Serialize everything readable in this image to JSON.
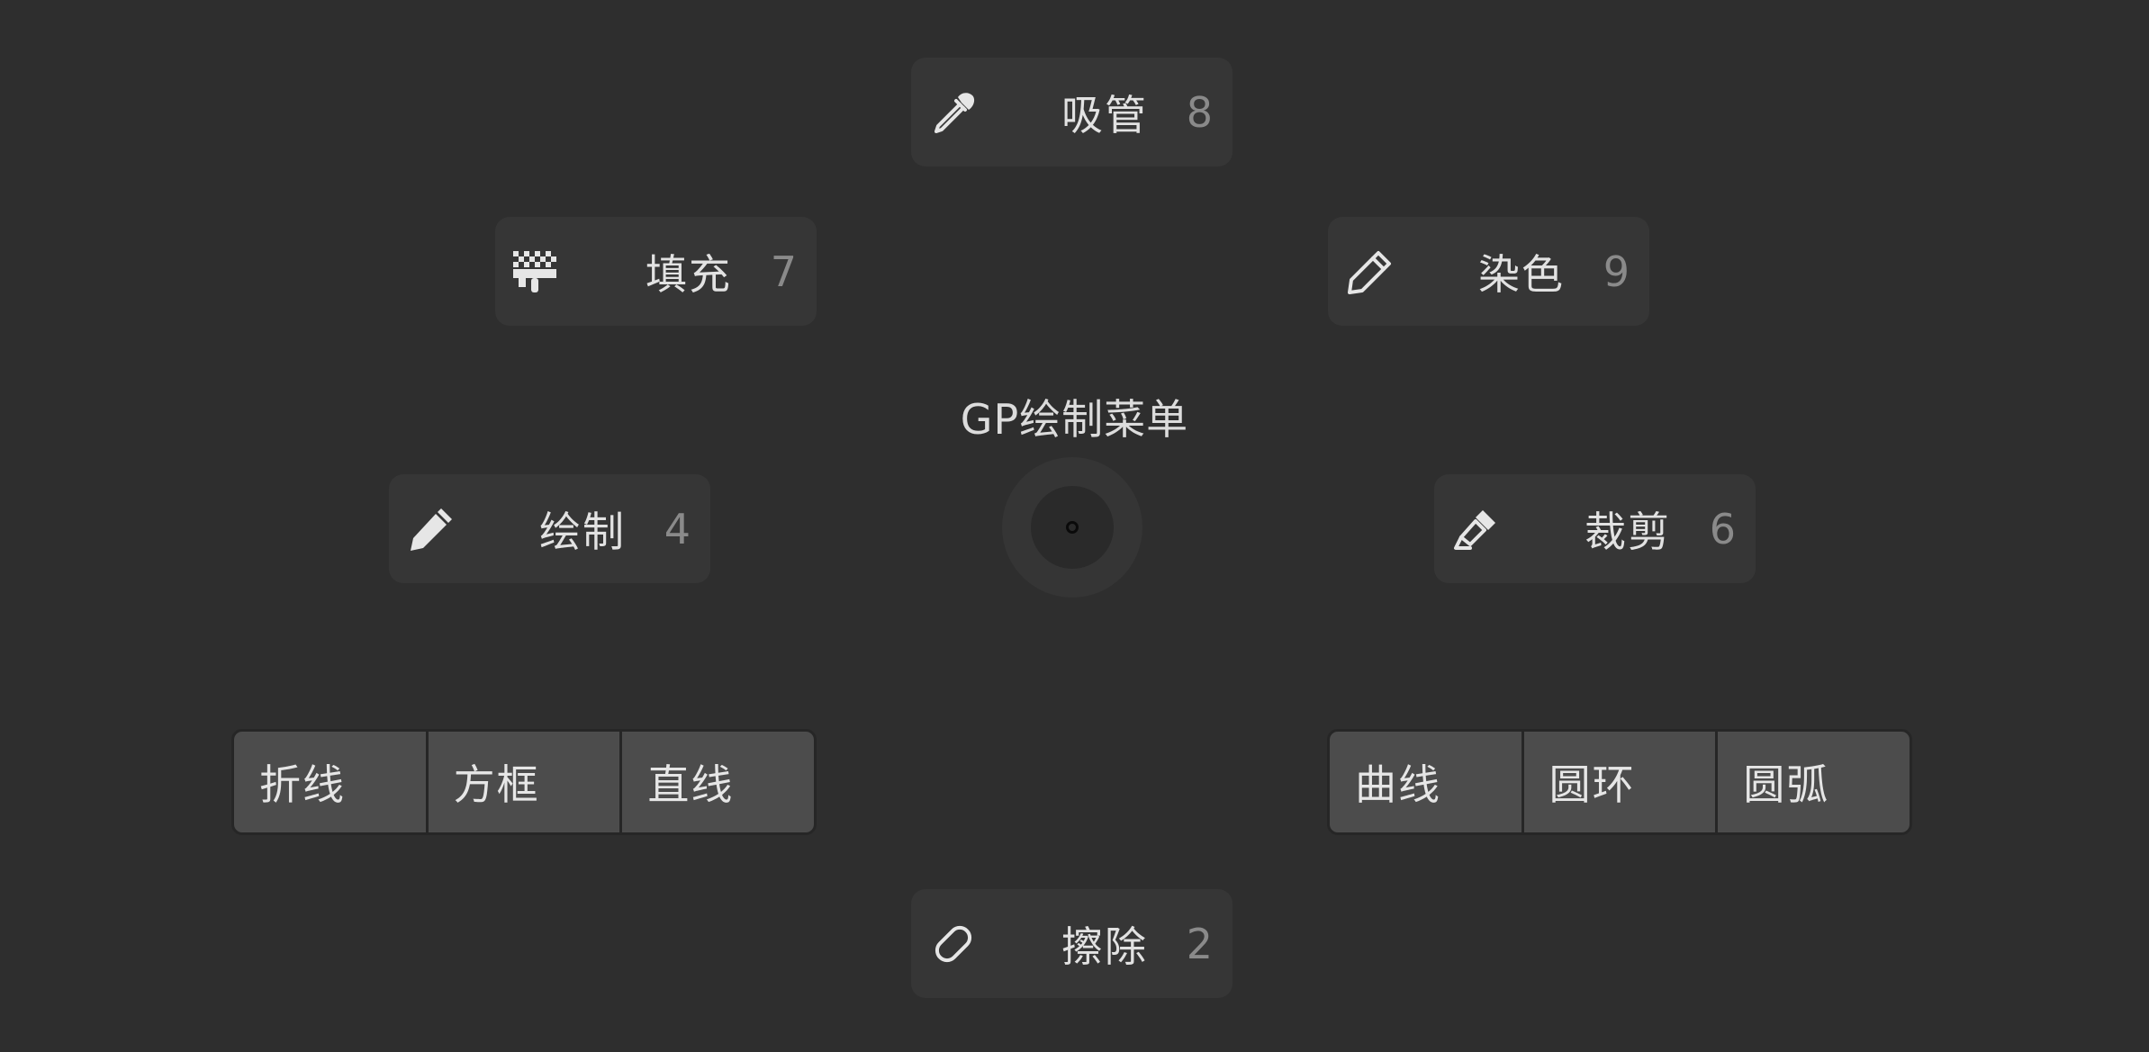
{
  "title": "GP绘制菜单",
  "items": {
    "eyedropper": {
      "label": "吸管",
      "key": "8",
      "icon": "eyedropper-icon"
    },
    "fill": {
      "label": "填充",
      "key": "7",
      "icon": "fill-checker-icon"
    },
    "tint": {
      "label": "染色",
      "key": "9",
      "icon": "pencil-outline-icon"
    },
    "draw": {
      "label": "绘制",
      "key": "4",
      "icon": "pencil-icon"
    },
    "cutter": {
      "label": "裁剪",
      "key": "6",
      "icon": "cutter-icon"
    },
    "erase": {
      "label": "擦除",
      "key": "2",
      "icon": "eraser-icon"
    }
  },
  "left_group": [
    "折线",
    "方框",
    "直线"
  ],
  "right_group": [
    "曲线",
    "圆环",
    "圆弧"
  ],
  "colors": {
    "background": "#2e2e2e",
    "item_bg": "#363636",
    "segment_bg": "#4c4c4c",
    "text": "#e2e2e2",
    "key_text": "#8a8a8a"
  }
}
